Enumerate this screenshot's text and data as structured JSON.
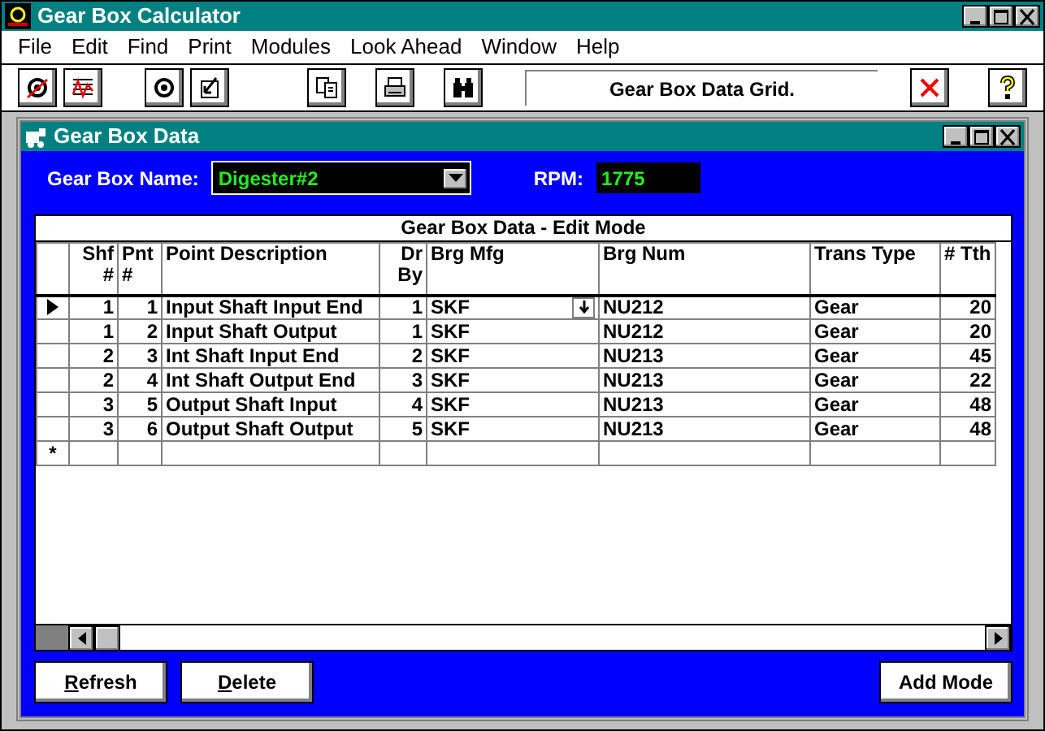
{
  "app": {
    "title": "Gear Box Calculator"
  },
  "menu": [
    "File",
    "Edit",
    "Find",
    "Print",
    "Modules",
    "Look Ahead",
    "Window",
    "Help"
  ],
  "toolbar": {
    "status_text": "Gear Box Data Grid."
  },
  "child_window": {
    "title": "Gear Box Data"
  },
  "gear_box_name": {
    "label": "Gear Box Name:",
    "value": "Digester#2"
  },
  "rpm": {
    "label": "RPM:",
    "value": "1775"
  },
  "grid": {
    "title": "Gear Box Data - Edit Mode",
    "columns": [
      "Shf #",
      "Pnt #",
      "Point Description",
      "Dr By",
      "Brg Mfg",
      "Brg Num",
      "Trans Type",
      "# Tth"
    ],
    "rows": [
      {
        "selected": true,
        "cells": [
          "1",
          "1",
          "Input Shaft Input End",
          "1",
          "SKF",
          "NU212",
          "Gear",
          "20"
        ]
      },
      {
        "selected": false,
        "cells": [
          "1",
          "2",
          "Input Shaft Output",
          "1",
          "SKF",
          "NU212",
          "Gear",
          "20"
        ]
      },
      {
        "selected": false,
        "cells": [
          "2",
          "3",
          "Int Shaft Input End",
          "2",
          "SKF",
          "NU213",
          "Gear",
          "45"
        ]
      },
      {
        "selected": false,
        "cells": [
          "2",
          "4",
          "Int Shaft Output End",
          "3",
          "SKF",
          "NU213",
          "Gear",
          "22"
        ]
      },
      {
        "selected": false,
        "cells": [
          "3",
          "5",
          "Output Shaft Input",
          "4",
          "SKF",
          "NU213",
          "Gear",
          "48"
        ]
      },
      {
        "selected": false,
        "cells": [
          "3",
          "6",
          "Output Shaft Output",
          "5",
          "SKF",
          "NU213",
          "Gear",
          "48"
        ]
      }
    ],
    "new_row_marker": "*"
  },
  "buttons_left": [
    {
      "label": "Refresh",
      "mnemonic": true
    },
    {
      "label": "Delete",
      "mnemonic": true
    }
  ],
  "buttons_right": [
    {
      "label": "Add Mode",
      "mnemonic": false
    }
  ]
}
